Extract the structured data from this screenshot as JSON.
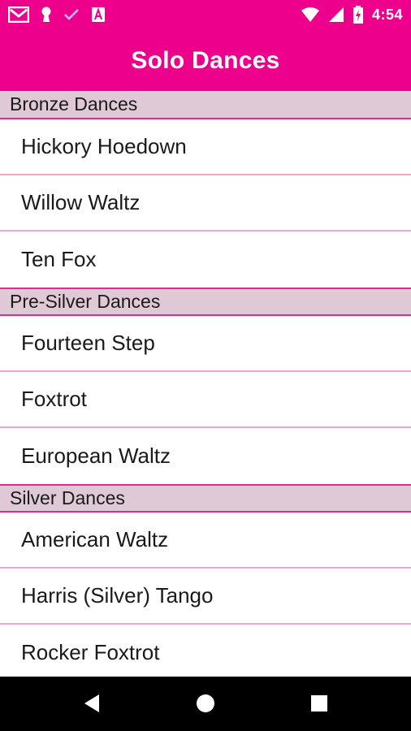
{
  "status_bar": {
    "time": "4:54",
    "icons": [
      "gmail-icon",
      "keyhole-icon",
      "check-icon",
      "font-a-icon",
      "wifi-icon",
      "cellular-signal-icon",
      "battery-charging-icon"
    ]
  },
  "app_bar": {
    "title": "Solo Dances"
  },
  "sections": [
    {
      "header": "Bronze Dances",
      "items": [
        "Hickory Hoedown",
        "Willow Waltz",
        "Ten Fox"
      ]
    },
    {
      "header": "Pre-Silver Dances",
      "items": [
        "Fourteen Step",
        "Foxtrot",
        "European Waltz"
      ]
    },
    {
      "header": "Silver Dances",
      "items": [
        "American Waltz",
        "Harris (Silver) Tango",
        "Rocker Foxtrot"
      ]
    }
  ],
  "nav_bar": {
    "buttons": [
      "back-icon",
      "home-icon",
      "recents-icon"
    ]
  },
  "colors": {
    "primary": "#ec008c",
    "section_header_bg": "#e0c9d6",
    "section_divider": "#e02a8f",
    "item_divider": "#f2a6cf"
  }
}
